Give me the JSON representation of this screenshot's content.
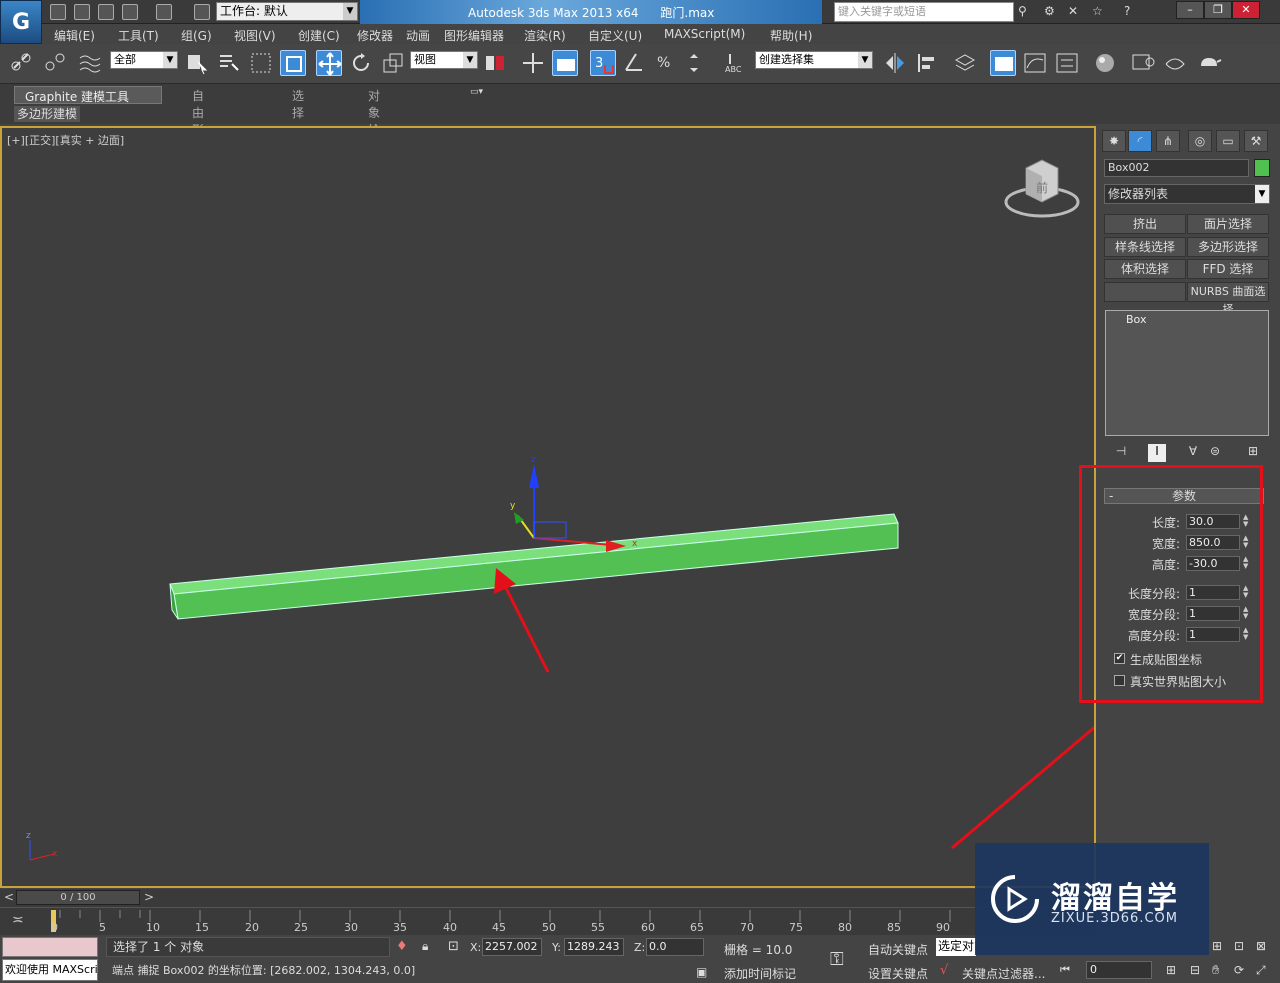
{
  "titlebar": {
    "workspace_label": "工作台: 默认",
    "app_title": "Autodesk 3ds Max  2013 x64",
    "file_name": "跑门.max",
    "search_placeholder": "键入关键字或短语"
  },
  "menubar": {
    "items": [
      "编辑(E)",
      "工具(T)",
      "组(G)",
      "视图(V)",
      "创建(C)",
      "修改器",
      "动画",
      "图形编辑器",
      "渲染(R)",
      "自定义(U)",
      "MAXScript(M)",
      "帮助(H)"
    ]
  },
  "toolbar": {
    "selection_filter": "全部",
    "ref_coord": "视图",
    "named_selection": "创建选择集"
  },
  "ribbon": {
    "tabs": [
      "Graphite 建模工具",
      "自由形式",
      "选择",
      "对象绘制"
    ],
    "panel_label": "多边形建模"
  },
  "viewport": {
    "label_bracket1": "[+]",
    "label_bracket2": "[正交]",
    "label_bracket3": "[真实 + 边面]",
    "axis_labels": {
      "x": "x",
      "y": "y",
      "z": "z"
    },
    "viewcube_face": "前"
  },
  "command_panel": {
    "object_name": "Box002",
    "object_color": "#50c050",
    "modifier_list": "修改器列表",
    "modifier_buttons": [
      "挤出",
      "面片选择",
      "样条线选择",
      "多边形选择",
      "体积选择",
      "FFD 选择",
      "",
      "NURBS 曲面选择"
    ],
    "stack_item": "Box",
    "params_title": "参数",
    "params": [
      {
        "label": "长度:",
        "value": "30.0"
      },
      {
        "label": "宽度:",
        "value": "850.0"
      },
      {
        "label": "高度:",
        "value": "-30.0"
      },
      {
        "label": "长度分段:",
        "value": "1"
      },
      {
        "label": "宽度分段:",
        "value": "1"
      },
      {
        "label": "高度分段:",
        "value": "1"
      }
    ],
    "checkboxes": [
      {
        "label": "生成贴图坐标",
        "checked": true
      },
      {
        "label": "真实世界贴图大小",
        "checked": false
      }
    ]
  },
  "timeline": {
    "frame_display": "0 / 100",
    "ticks": [
      "0",
      "5",
      "10",
      "15",
      "20",
      "25",
      "30",
      "35",
      "40",
      "45",
      "50",
      "55",
      "60",
      "65",
      "70",
      "75",
      "80",
      "85",
      "90"
    ]
  },
  "statusbar": {
    "maxscript_text": "欢迎使用 MAXScri",
    "selection_status": "选择了 1 个 对象",
    "prompt": "端点 捕捉 Box002 的坐标位置:  [2682.002, 1304.243, 0.0]",
    "x_label": "X:",
    "x_value": "2257.002",
    "y_label": "Y:",
    "y_value": "1289.243",
    "z_label": "Z:",
    "z_value": "0.0",
    "grid": "栅格 = 10.0",
    "add_time_tag": "添加时间标记",
    "auto_key": "自动关键点",
    "set_key": "设置关键点",
    "selected_filter": "选定对象",
    "key_filters": "关键点过滤器...",
    "frame_value": "0"
  },
  "watermark": {
    "brand": "溜溜自学",
    "url": "ZIXUE.3D66.COM"
  },
  "colors": {
    "accent_blue": "#3d8bd6",
    "viewport_border": "#c8a23a",
    "box_green": "#50c050",
    "annotation_red": "#e3101a"
  }
}
